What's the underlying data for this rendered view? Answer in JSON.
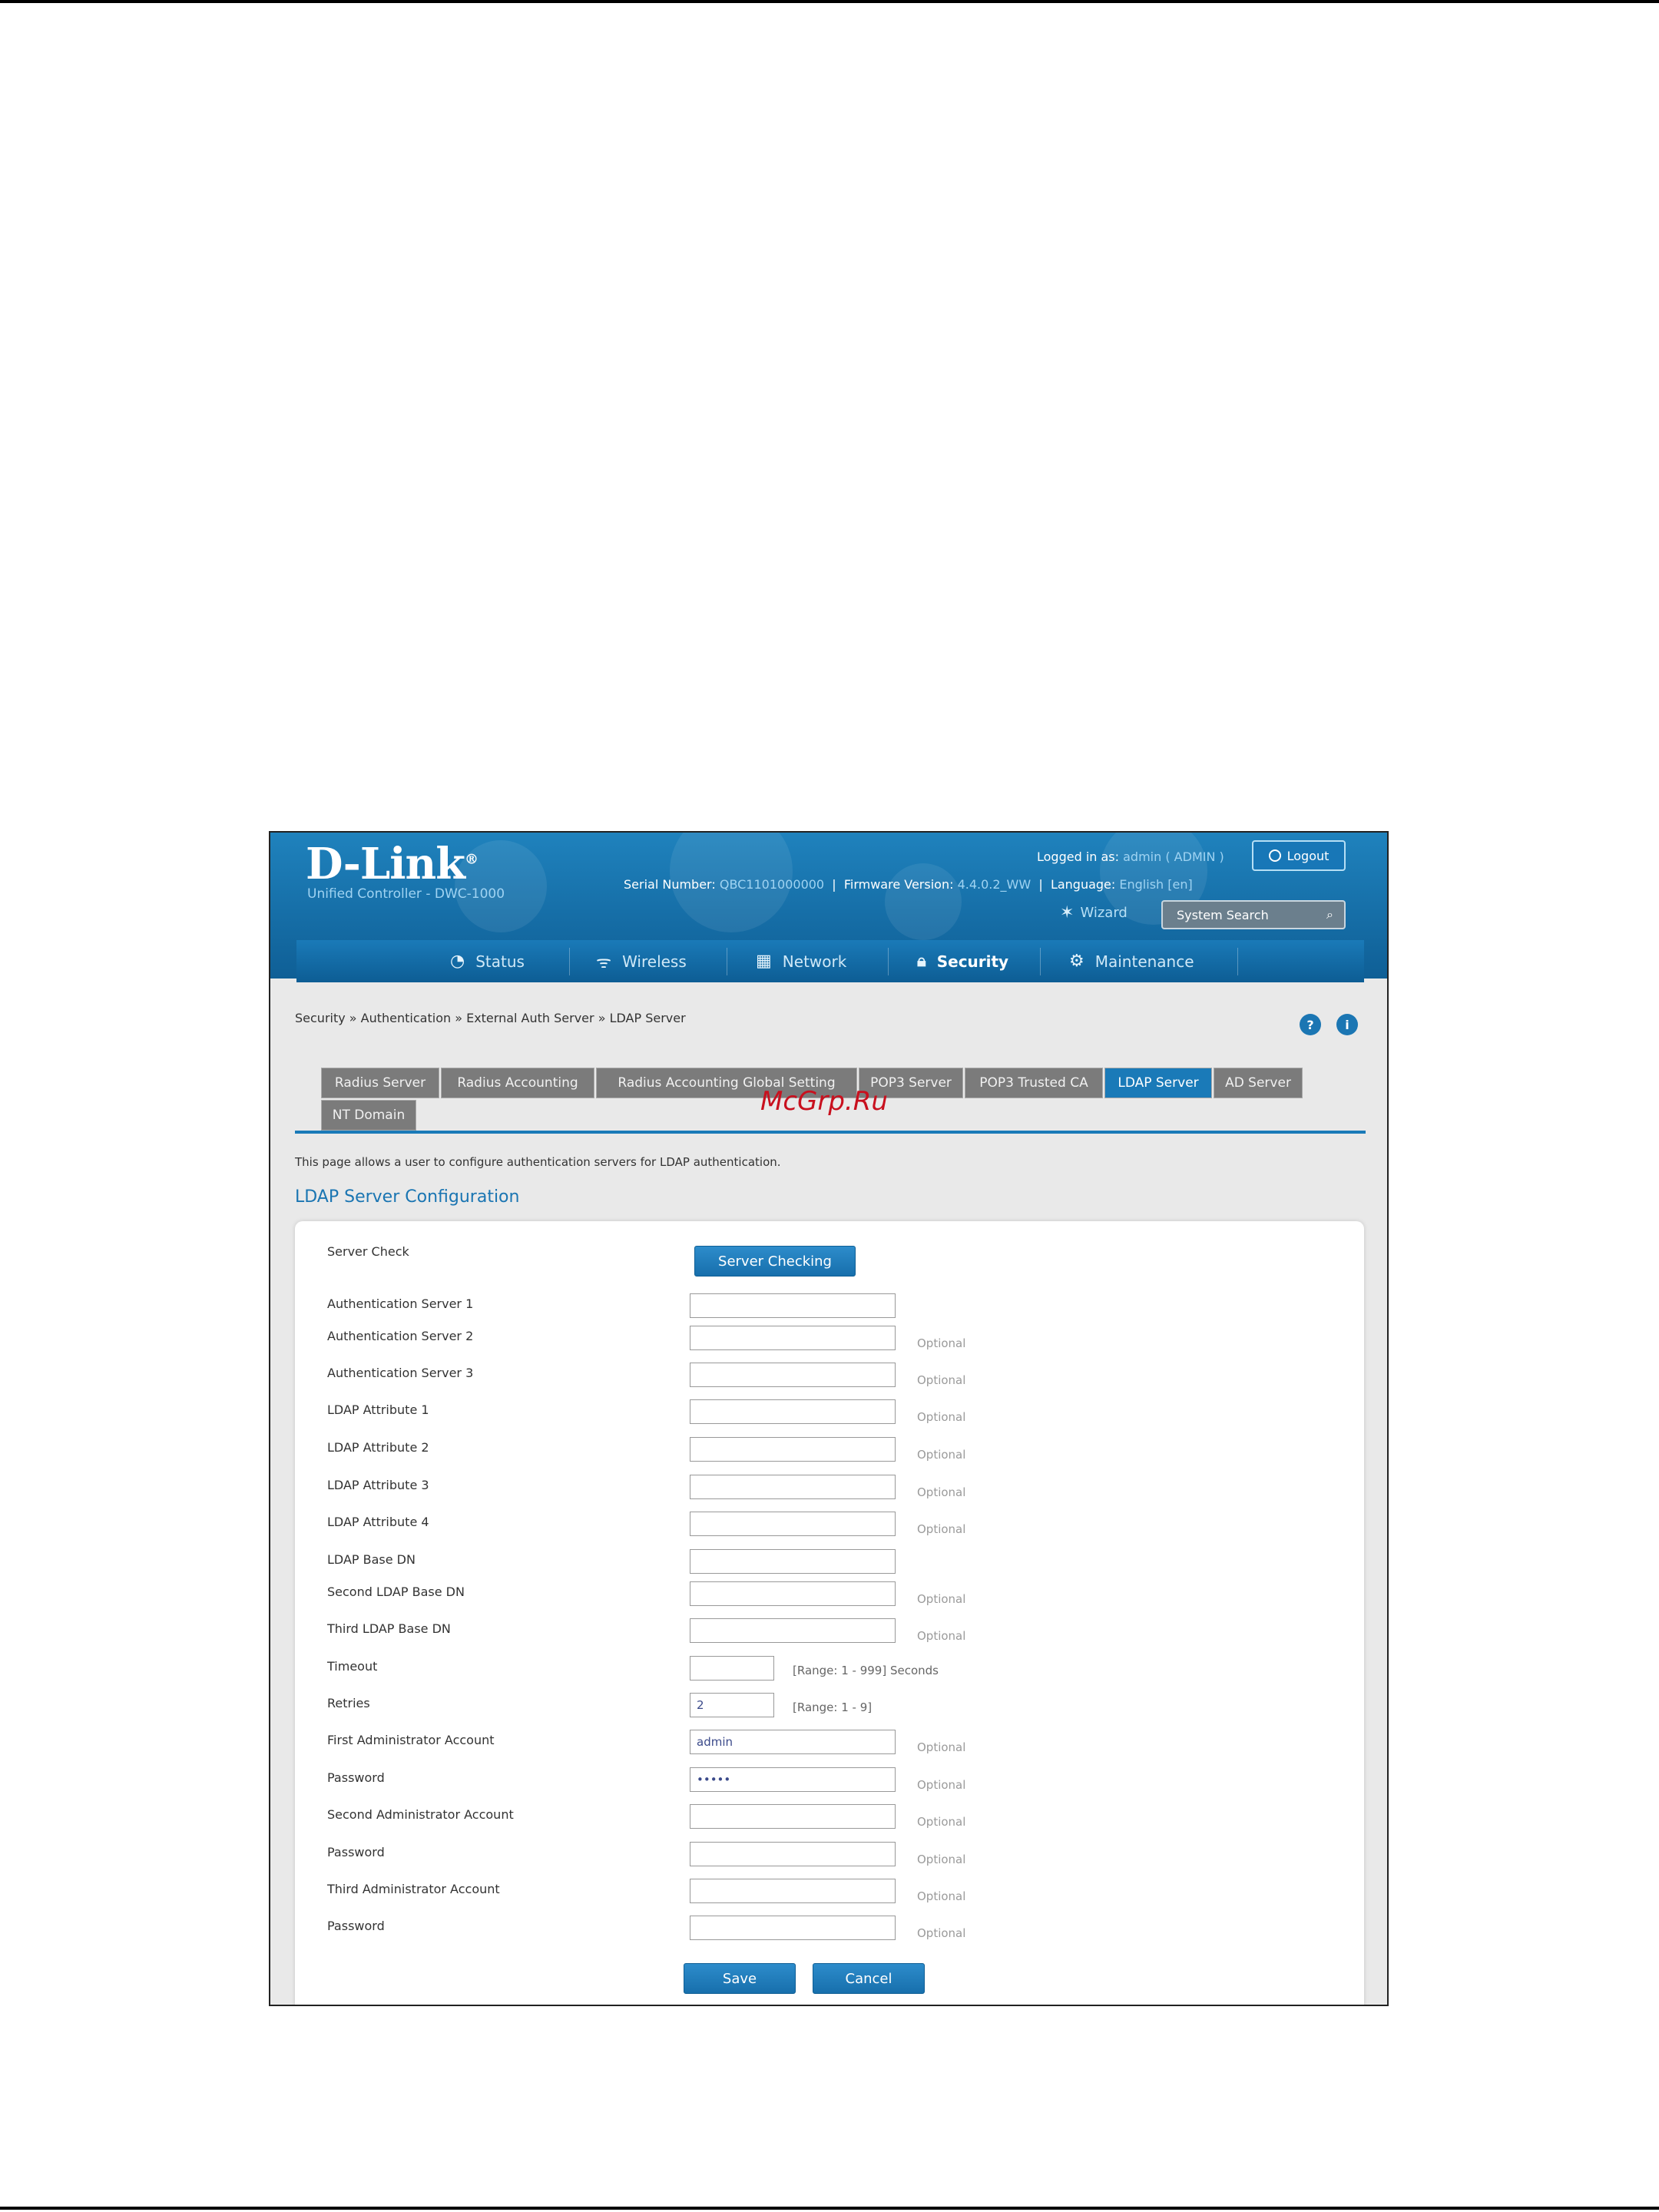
{
  "header": {
    "logo": "D-Link",
    "tagline": "Unified Controller - DWC-1000",
    "serial_label": "Serial Number:",
    "serial_value": "QBC1101000000",
    "firmware_label": "Firmware Version:",
    "firmware_value": "4.4.0.2_WW",
    "language_label": "Language:",
    "language_value": "English [en]",
    "logged_label": "Logged in as:",
    "logged_value": "admin ( ADMIN )",
    "logout": "Logout",
    "wizard": "Wizard",
    "search_placeholder": "System Search"
  },
  "nav": [
    {
      "label": "Status",
      "icon": "gauge-icon"
    },
    {
      "label": "Wireless",
      "icon": "wifi-icon"
    },
    {
      "label": "Network",
      "icon": "network-icon"
    },
    {
      "label": "Security",
      "icon": "lock-icon",
      "active": true
    },
    {
      "label": "Maintenance",
      "icon": "gears-icon"
    }
  ],
  "breadcrumb": "Security  »  Authentication  »  External Auth Server  »  LDAP Server",
  "tabs": [
    "Radius Server",
    "Radius Accounting",
    "Radius Accounting Global Setting",
    "POP3 Server",
    "POP3 Trusted CA",
    "LDAP Server",
    "AD Server",
    "NT Domain"
  ],
  "watermark": "McGrp.Ru",
  "description": "This page allows a user to configure authentication servers for LDAP authentication.",
  "section_title": "LDAP Server Configuration",
  "form": {
    "server_check_label": "Server Check",
    "server_check_button": "Server Checking",
    "fields": [
      {
        "label": "Authentication Server 1",
        "value": "",
        "hint": ""
      },
      {
        "label": "Authentication Server 2",
        "value": "",
        "hint": "Optional"
      },
      {
        "label": "Authentication Server 3",
        "value": "",
        "hint": "Optional"
      },
      {
        "label": "LDAP Attribute 1",
        "value": "",
        "hint": "Optional"
      },
      {
        "label": "LDAP Attribute 2",
        "value": "",
        "hint": "Optional"
      },
      {
        "label": "LDAP Attribute 3",
        "value": "",
        "hint": "Optional"
      },
      {
        "label": "LDAP Attribute 4",
        "value": "",
        "hint": "Optional"
      },
      {
        "label": "LDAP Base DN",
        "value": "",
        "hint": ""
      },
      {
        "label": "Second LDAP Base DN",
        "value": "",
        "hint": "Optional"
      },
      {
        "label": "Third LDAP Base DN",
        "value": "",
        "hint": "Optional"
      },
      {
        "label": "Timeout",
        "value": "",
        "hint": "[Range: 1 - 999] Seconds"
      },
      {
        "label": "Retries",
        "value": "2",
        "hint": "[Range: 1 - 9]"
      },
      {
        "label": "First Administrator Account",
        "value": "admin",
        "hint": "Optional"
      },
      {
        "label": "Password",
        "value": "•••••",
        "hint": "Optional"
      },
      {
        "label": "Second Administrator Account",
        "value": "",
        "hint": "Optional"
      },
      {
        "label": "Password",
        "value": "",
        "hint": "Optional"
      },
      {
        "label": "Third Administrator Account",
        "value": "",
        "hint": "Optional"
      },
      {
        "label": "Password",
        "value": "",
        "hint": "Optional"
      }
    ],
    "save": "Save",
    "cancel": "Cancel"
  }
}
